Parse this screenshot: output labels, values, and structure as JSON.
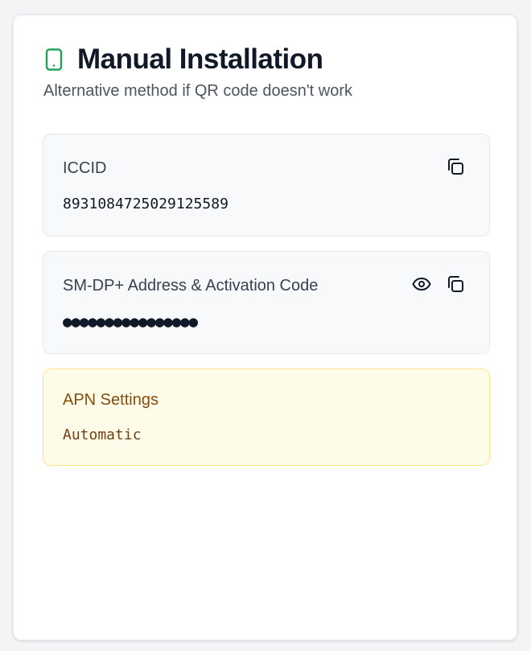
{
  "header": {
    "title": "Manual Installation",
    "subtitle": "Alternative method if QR code doesn't work",
    "icon": "smartphone-icon",
    "accent_color": "#22a35a"
  },
  "iccid": {
    "label": "ICCID",
    "value": "8931084725029125589",
    "copy_icon": "copy-icon"
  },
  "smdp": {
    "label": "SM-DP+ Address & Activation Code",
    "value_masked": "●●●●●●●●●●●●●●●●",
    "reveal_icon": "eye-icon",
    "copy_icon": "copy-icon"
  },
  "apn": {
    "label": "APN Settings",
    "value": "Automatic",
    "background_color": "#fefbe8",
    "border_color": "#fde68a"
  }
}
